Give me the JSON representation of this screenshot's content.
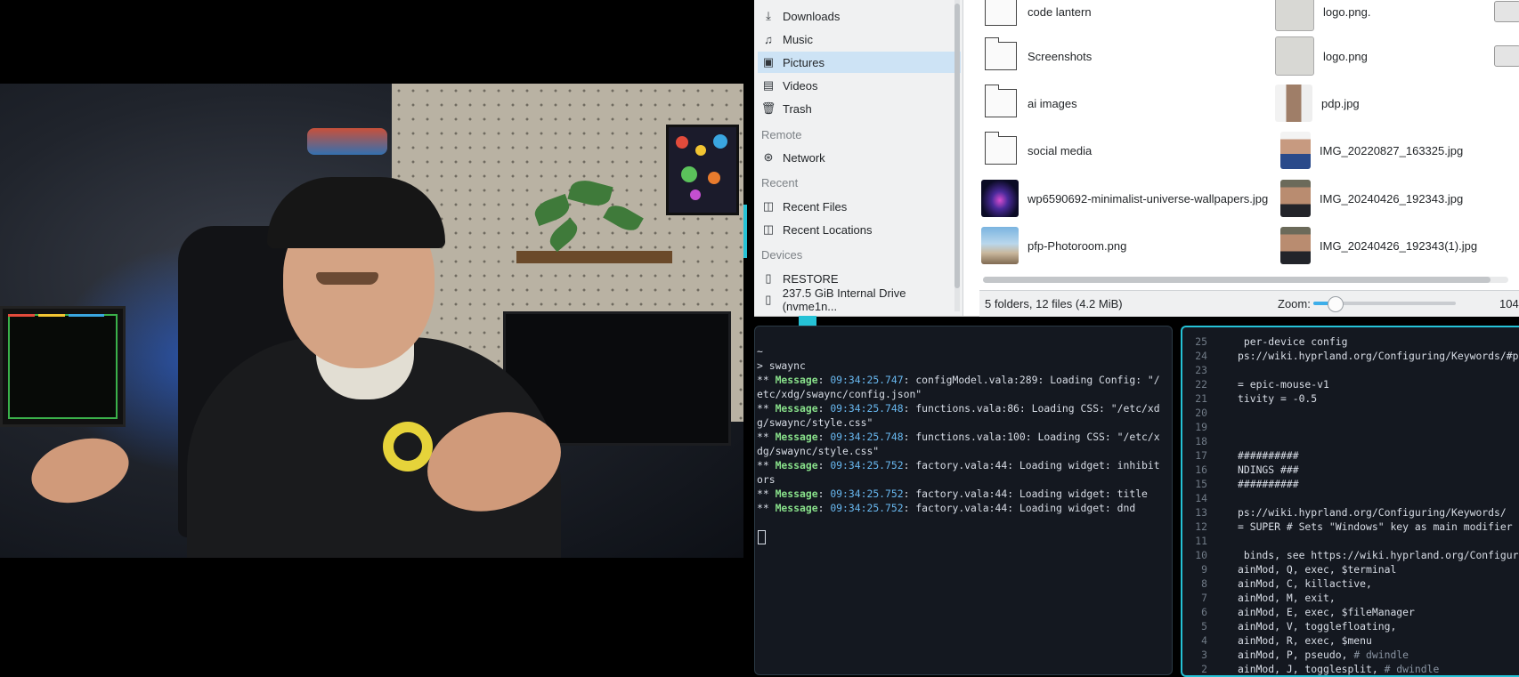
{
  "video": {
    "description_icon": "video-frame"
  },
  "file_manager": {
    "sidebar": {
      "places": [
        {
          "label": "Downloads",
          "icon": "download-icon"
        },
        {
          "label": "Music",
          "icon": "music-icon"
        },
        {
          "label": "Pictures",
          "icon": "pictures-icon",
          "active": true
        },
        {
          "label": "Videos",
          "icon": "video-icon"
        },
        {
          "label": "Trash",
          "icon": "trash-icon"
        }
      ],
      "remote_header": "Remote",
      "network_label": "Network",
      "recent_header": "Recent",
      "recent_files_label": "Recent Files",
      "recent_locations_label": "Recent Locations",
      "devices_header": "Devices",
      "restore_label": "RESTORE",
      "drive_label": "237.5 GiB Internal Drive (nvme1n..."
    },
    "files_col1": [
      {
        "name": "code lantern",
        "type": "folder"
      },
      {
        "name": "Screenshots",
        "type": "folder"
      },
      {
        "name": "ai images",
        "type": "folder"
      },
      {
        "name": "social media",
        "type": "folder"
      },
      {
        "name": "wp6590692-minimalist-universe-wallpapers.jpg",
        "type": "image"
      },
      {
        "name": "pfp-Photoroom.png",
        "type": "image"
      }
    ],
    "files_col2": [
      {
        "name": "logo.png.",
        "type": "image"
      },
      {
        "name": "logo.png",
        "type": "image"
      },
      {
        "name": "pdp.jpg",
        "type": "image"
      },
      {
        "name": "IMG_20220827_163325.jpg",
        "type": "image"
      },
      {
        "name": "IMG_20240426_192343.jpg",
        "type": "image"
      },
      {
        "name": "IMG_20240426_192343(1).jpg",
        "type": "image"
      }
    ],
    "status": {
      "summary": "5 folders, 12 files (4.2 MiB)",
      "zoom_label": "Zoom:",
      "zoom_value": "104",
      "zoom_level": 0.15
    }
  },
  "terminal_left": {
    "lines": [
      {
        "plain": "~"
      },
      {
        "plain": "> swaync"
      },
      {
        "msg": "** ",
        "tag": "Message",
        "time": "09:34:25.747",
        "text": ": configModel.vala:289: Loading Config: \"/"
      },
      {
        "plain": "etc/xdg/swaync/config.json\""
      },
      {
        "msg": "** ",
        "tag": "Message",
        "time": "09:34:25.748",
        "text": ": functions.vala:86: Loading CSS: \"/etc/xd"
      },
      {
        "plain": "g/swaync/style.css\""
      },
      {
        "msg": "** ",
        "tag": "Message",
        "time": "09:34:25.748",
        "text": ": functions.vala:100: Loading CSS: \"/etc/x"
      },
      {
        "plain": "dg/swaync/style.css\""
      },
      {
        "msg": "** ",
        "tag": "Message",
        "time": "09:34:25.752",
        "text": ": factory.vala:44: Loading widget: inhibit"
      },
      {
        "plain": "ors"
      },
      {
        "msg": "** ",
        "tag": "Message",
        "time": "09:34:25.752",
        "text": ": factory.vala:44: Loading widget: title"
      },
      {
        "msg": "** ",
        "tag": "Message",
        "time": "09:34:25.752",
        "text": ": factory.vala:44: Loading widget: dnd"
      }
    ]
  },
  "terminal_right": {
    "lines": [
      {
        "num": "25",
        "text": " per-device config",
        "comment": ""
      },
      {
        "num": "24",
        "text": "ps://wiki.hyprland.org/Configuring/Keywords/#p",
        "comment": ""
      },
      {
        "num": "23",
        "text": "",
        "comment": ""
      },
      {
        "num": "22",
        "text": "= epic-mouse-v1",
        "comment": ""
      },
      {
        "num": "21",
        "text": "tivity = -0.5",
        "comment": ""
      },
      {
        "num": "20",
        "text": "",
        "comment": ""
      },
      {
        "num": "19",
        "text": "",
        "comment": ""
      },
      {
        "num": "18",
        "text": "",
        "comment": ""
      },
      {
        "num": "17",
        "text": "##########",
        "comment": ""
      },
      {
        "num": "16",
        "text": "NDINGS ###",
        "comment": ""
      },
      {
        "num": "15",
        "text": "##########",
        "comment": ""
      },
      {
        "num": "14",
        "text": "",
        "comment": ""
      },
      {
        "num": "13",
        "text": "ps://wiki.hyprland.org/Configuring/Keywords/",
        "comment": ""
      },
      {
        "num": "12",
        "text": "= SUPER # Sets \"Windows\" key as main modifier",
        "comment": ""
      },
      {
        "num": "11",
        "text": "",
        "comment": ""
      },
      {
        "num": "10",
        "text": " binds, see https://wiki.hyprland.org/Configuri",
        "comment": ""
      },
      {
        "num": "9",
        "text": "ainMod, Q, exec, $terminal",
        "comment": ""
      },
      {
        "num": "8",
        "text": "ainMod, C, killactive,",
        "comment": ""
      },
      {
        "num": "7",
        "text": "ainMod, M, exit,",
        "comment": ""
      },
      {
        "num": "6",
        "text": "ainMod, E, exec, $fileManager",
        "comment": ""
      },
      {
        "num": "5",
        "text": "ainMod, V, togglefloating,",
        "comment": ""
      },
      {
        "num": "4",
        "text": "ainMod, R, exec, $menu",
        "comment": ""
      },
      {
        "num": "3",
        "text": "ainMod, P, pseudo, ",
        "comment": "# dwindle"
      },
      {
        "num": "2",
        "text": "ainMod, J, togglesplit, ",
        "comment": "# dwindle"
      }
    ]
  },
  "colors": {
    "accent": "#25c2d6",
    "terminal_bg": "#141820",
    "selection": "#cde3f5"
  }
}
